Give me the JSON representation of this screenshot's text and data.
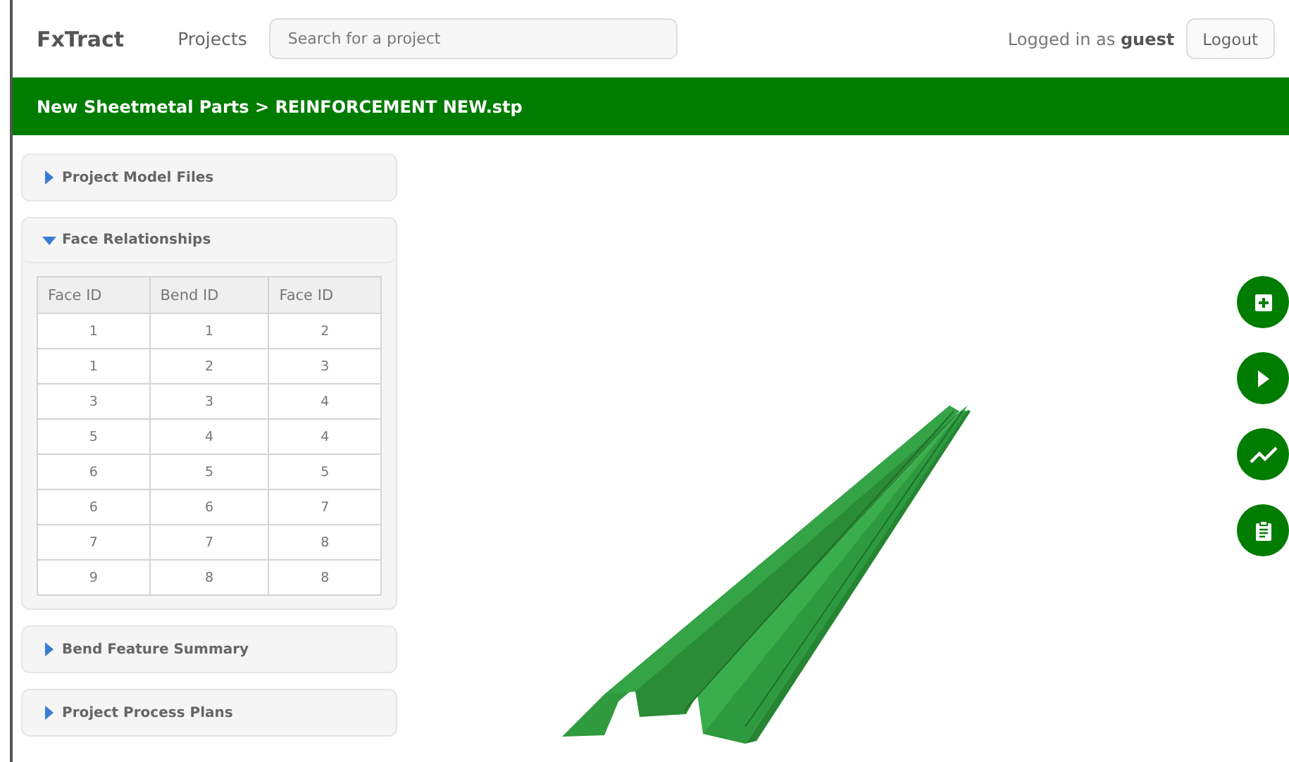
{
  "nav": {
    "brand": "FxTract",
    "link": "Projects",
    "search": {
      "placeholder": "Search for a project"
    },
    "user_prefix": "Logged in as",
    "user": "guest",
    "logout": "Logout"
  },
  "breadcrumb": "New Sheetmetal Parts > REINFORCEMENT NEW.stp",
  "sections": [
    {
      "title": "Project Model Files",
      "expanded": false
    },
    {
      "title": "Face Relationships",
      "expanded": true,
      "table": {
        "columns": [
          "Face ID",
          "Bend ID",
          "Face ID"
        ],
        "rows": [
          [
            "1",
            "1",
            "2"
          ],
          [
            "1",
            "2",
            "3"
          ],
          [
            "3",
            "3",
            "4"
          ],
          [
            "5",
            "4",
            "4"
          ],
          [
            "6",
            "5",
            "5"
          ],
          [
            "6",
            "6",
            "7"
          ],
          [
            "7",
            "7",
            "8"
          ],
          [
            "9",
            "8",
            "8"
          ]
        ]
      }
    },
    {
      "title": "Bend Feature Summary",
      "expanded": false
    },
    {
      "title": "Project Process Plans",
      "expanded": false
    }
  ],
  "tools": [
    {
      "kind": "add"
    },
    {
      "kind": "play"
    },
    {
      "kind": "chart"
    },
    {
      "kind": "clipboard"
    }
  ]
}
